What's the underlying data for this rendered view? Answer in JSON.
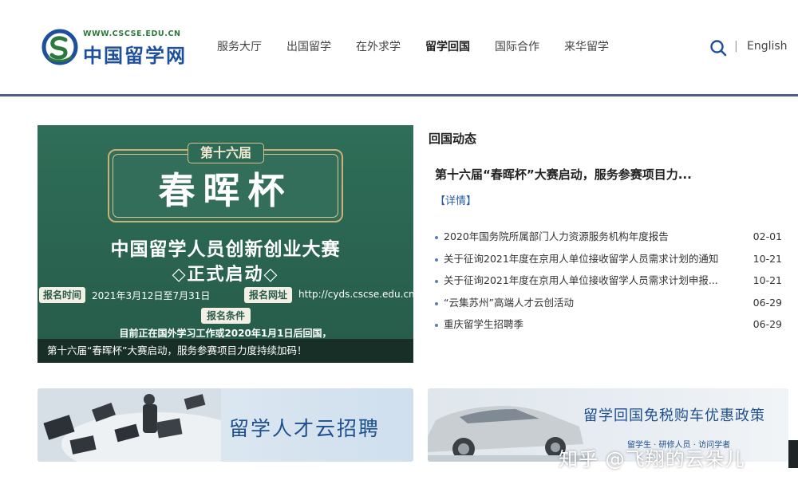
{
  "colors": {
    "brand_blue": "#1d4f9c",
    "brand_green": "#2b7a3b",
    "header_line": "#4a5e93",
    "banner_green": "#2f6e58",
    "link_blue": "#2a5da8"
  },
  "header": {
    "logo_url": "WWW.CSCSE.EDU.CN",
    "logo_name": "中国留学网",
    "nav": [
      {
        "label": "服务大厅",
        "active": false
      },
      {
        "label": "出国留学",
        "active": false
      },
      {
        "label": "在外求学",
        "active": false
      },
      {
        "label": "留学回国",
        "active": true
      },
      {
        "label": "国际合作",
        "active": false
      },
      {
        "label": "来华留学",
        "active": false
      }
    ],
    "search_icon": "search-icon",
    "separator": "|",
    "language": "English"
  },
  "banner": {
    "tag": "第十六届",
    "title": "春晖杯",
    "subtitle1": "中国留学人员创新创业大赛",
    "subtitle2": "◇正式启动◇",
    "time_label": "报名时间",
    "time_value": "2021年3月12日至7月31日",
    "url_label": "报名网址",
    "url_value": "http://cyds.cscse.edu.cn",
    "cond_label": "报名条件",
    "cond_text": "目前正在国外学习工作或2020年1月1日后回国，",
    "caption": "第十六届“春晖杯”大赛启动，服务参赛项目力度持续加码！"
  },
  "news": {
    "heading": "回国动态",
    "headline": "第十六届“春晖杯”大赛启动，服务参赛项目力...",
    "detail_link": "【详情】",
    "items": [
      {
        "title": "2020年国务院所属部门人力资源服务机构年度报告",
        "date": "02-01"
      },
      {
        "title": "关于征询2021年度在京用人单位接收留学人员需求计划的通知",
        "date": "10-21"
      },
      {
        "title": "关于征询2021年度在京用人单位接收留学人员需求计划申报...",
        "date": "10-21"
      },
      {
        "title": "“云集苏州”高端人才云创活动",
        "date": "06-29"
      },
      {
        "title": "重庆留学生招聘季",
        "date": "06-29"
      }
    ]
  },
  "cards": {
    "left_title": "留学人才云招聘",
    "right_title": "留学回国免税购车优惠政策",
    "right_sub": "留学生 · 研修人员 · 访问学者"
  },
  "watermark": "知乎 @飞翔的云朵儿"
}
